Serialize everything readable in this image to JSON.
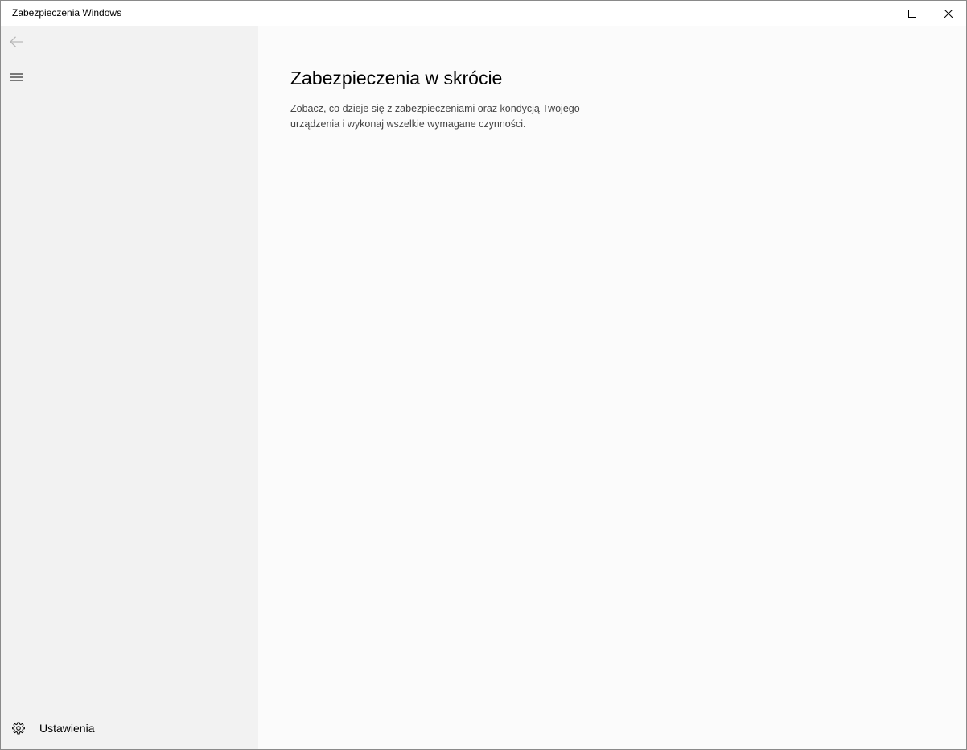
{
  "window": {
    "title": "Zabezpieczenia Windows",
    "minimize_icon": "minimize-icon",
    "maximize_icon": "maximize-icon",
    "close_icon": "close-icon"
  },
  "sidebar": {
    "back_icon": "arrow-left-icon",
    "menu_icon": "hamburger-menu-icon",
    "settings": {
      "icon": "gear-icon",
      "label": "Ustawienia"
    }
  },
  "main": {
    "title": "Zabezpieczenia w skrócie",
    "description": "Zobacz, co dzieje się z zabezpieczeniami oraz kondycją Twojego urządzenia i wykonaj wszelkie wymagane czynności."
  },
  "colors": {
    "sidebar_bg": "#f2f2f2",
    "main_bg": "#fbfbfb",
    "titlebar_bg": "#ffffff"
  }
}
